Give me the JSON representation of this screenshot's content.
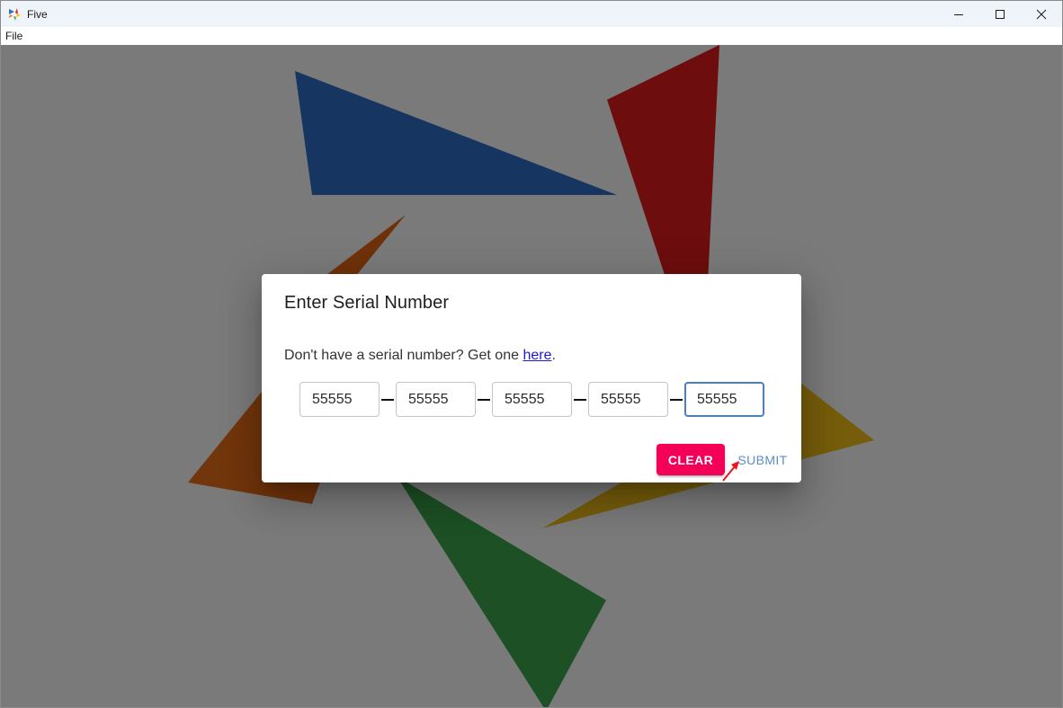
{
  "window": {
    "title": "Five",
    "icon": "five-app-icon",
    "controls": [
      "minimize-icon",
      "maximize-icon",
      "close-icon"
    ]
  },
  "menu": {
    "items": [
      {
        "label": "File"
      }
    ]
  },
  "dialog": {
    "title": "Enter Serial Number",
    "prompt_before": "Don't have a serial number? Get one ",
    "link_label": "here",
    "prompt_after": ".",
    "serial_fields": [
      {
        "value": "55555"
      },
      {
        "value": "55555"
      },
      {
        "value": "55555"
      },
      {
        "value": "55555"
      },
      {
        "value": "55555",
        "focused": true
      }
    ],
    "clear_label": "CLEAR",
    "submit_label": "SUBMIT"
  },
  "colors": {
    "clear_button": "#f50057",
    "submit_button": "#5b8ec7",
    "focused_border": "#4a7fc1",
    "triangle_blue": "#2f6fca",
    "triangle_red": "#e31d1d",
    "triangle_orange": "#f0731b",
    "triangle_yellow": "#f7c318",
    "triangle_green": "#3ea84b"
  }
}
